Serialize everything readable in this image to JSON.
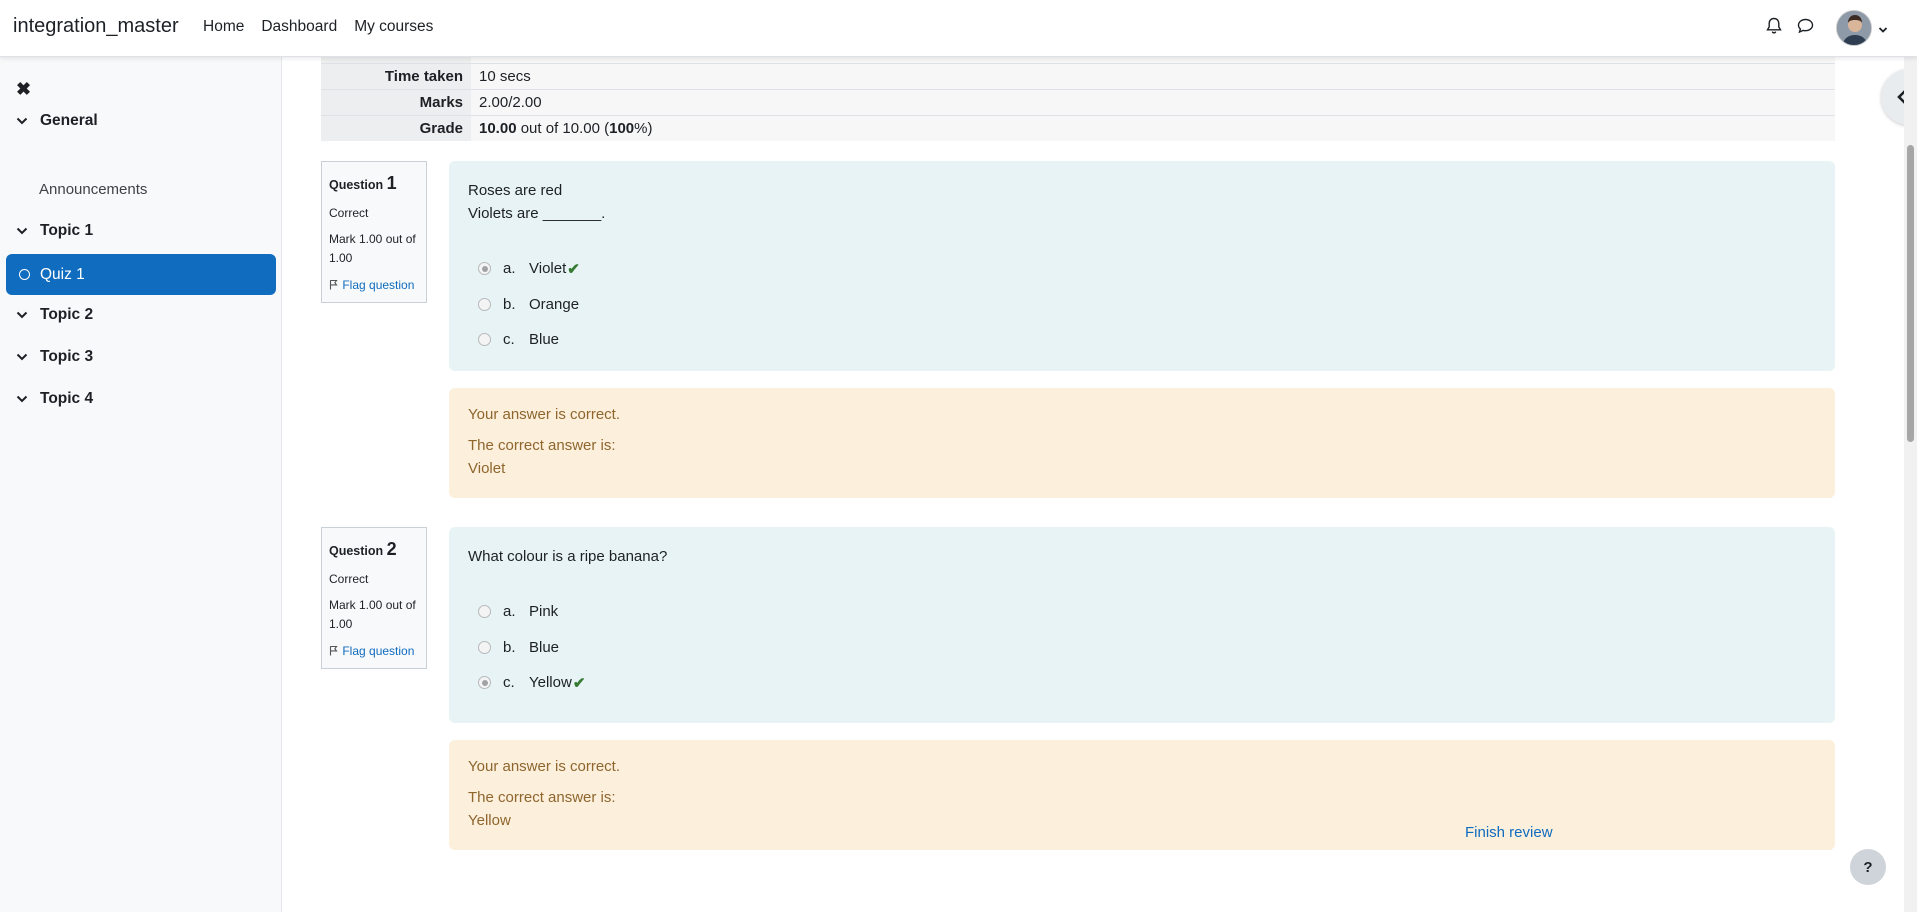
{
  "navbar": {
    "brand": "integration_master",
    "links": [
      "Home",
      "Dashboard",
      "My courses"
    ]
  },
  "drawer": {
    "sections": [
      {
        "label": "General"
      },
      {
        "label": "Topic 1"
      },
      {
        "label": "Topic 2"
      },
      {
        "label": "Topic 3"
      },
      {
        "label": "Topic 4"
      }
    ],
    "announcements": "Announcements",
    "active_item": "Quiz 1"
  },
  "summary": {
    "time_taken_label": "Time taken",
    "time_taken_value": "10 secs",
    "marks_label": "Marks",
    "marks_value": "2.00/2.00",
    "grade_label": "Grade",
    "grade_value_bold": "10.00",
    "grade_value_mid": " out of 10.00 (",
    "grade_percent_bold": "100",
    "grade_value_end": "%)"
  },
  "questions": [
    {
      "label": "Question",
      "number": "1",
      "state": "Correct",
      "mark": "Mark 1.00 out of 1.00",
      "flag": "Flag question",
      "text_line1": "Roses are red",
      "text_line2": "Violets are _______.",
      "answers": [
        {
          "letter": "a.",
          "text": "Violet",
          "checked": true,
          "correct": true
        },
        {
          "letter": "b.",
          "text": "Orange",
          "checked": false,
          "correct": false
        },
        {
          "letter": "c.",
          "text": "Blue",
          "checked": false,
          "correct": false
        }
      ],
      "feedback": "Your answer is correct.",
      "right_answer_label": "The correct answer is:",
      "right_answer": "Violet"
    },
    {
      "label": "Question",
      "number": "2",
      "state": "Correct",
      "mark": "Mark 1.00 out of 1.00",
      "flag": "Flag question",
      "text_line1": "What colour is a ripe banana?",
      "text_line2": "",
      "answers": [
        {
          "letter": "a.",
          "text": "Pink",
          "checked": false,
          "correct": false
        },
        {
          "letter": "b.",
          "text": "Blue",
          "checked": false,
          "correct": false
        },
        {
          "letter": "c.",
          "text": "Yellow",
          "checked": true,
          "correct": true
        }
      ],
      "feedback": "Your answer is correct.",
      "right_answer_label": "The correct answer is:",
      "right_answer": "Yellow"
    }
  ],
  "finish_review": "Finish review",
  "help": "?",
  "colors": {
    "brand_blue": "#0f6cbf",
    "formulation_bg": "#e7f3f5",
    "outcome_bg": "#fcefdc",
    "correct_green": "#357a32"
  }
}
